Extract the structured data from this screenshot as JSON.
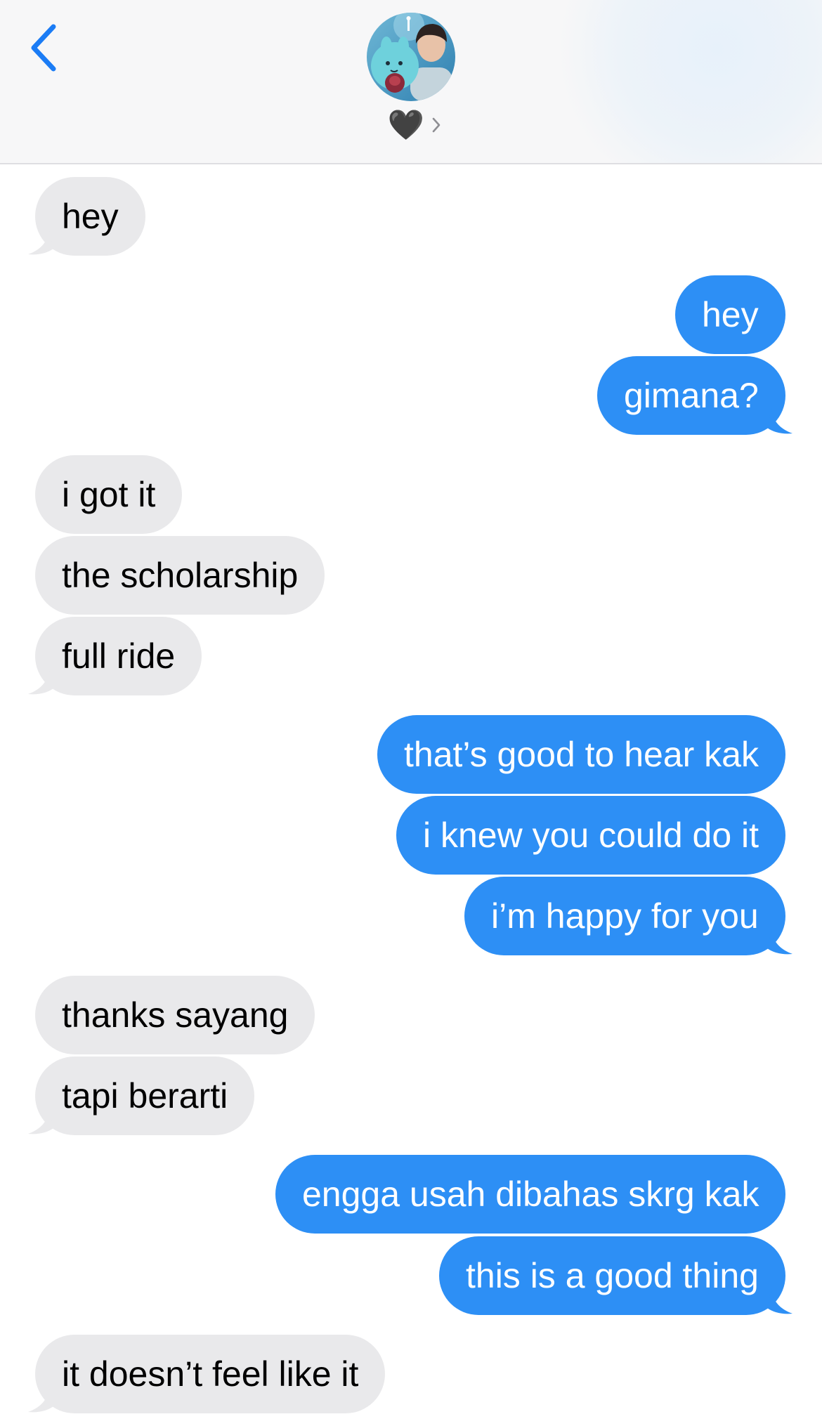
{
  "header": {
    "contact_name": "🖤",
    "back_icon": "chevron-left-icon",
    "avatar_icon": "contact-avatar-photo",
    "disclosure_icon": "chevron-right-icon",
    "accent_color": "#1b7cf5"
  },
  "colors": {
    "incoming_bubble": "#e9e9eb",
    "outgoing_bubble": "#2d8ff5",
    "outgoing_text": "#ffffff",
    "incoming_text": "#000000"
  },
  "messages": [
    {
      "direction": "incoming",
      "text": "hey"
    },
    {
      "direction": "outgoing",
      "text": "hey"
    },
    {
      "direction": "outgoing",
      "text": "gimana?"
    },
    {
      "direction": "incoming",
      "text": "i got it"
    },
    {
      "direction": "incoming",
      "text": "the scholarship"
    },
    {
      "direction": "incoming",
      "text": "full ride"
    },
    {
      "direction": "outgoing",
      "text": "that’s good to hear kak"
    },
    {
      "direction": "outgoing",
      "text": "i knew you could do it"
    },
    {
      "direction": "outgoing",
      "text": "i’m happy for you"
    },
    {
      "direction": "incoming",
      "text": "thanks sayang"
    },
    {
      "direction": "incoming",
      "text": "tapi berarti"
    },
    {
      "direction": "outgoing",
      "text": "engga usah dibahas skrg kak"
    },
    {
      "direction": "outgoing",
      "text": "this is a good thing"
    },
    {
      "direction": "incoming",
      "text": "it doesn’t feel like it"
    }
  ]
}
